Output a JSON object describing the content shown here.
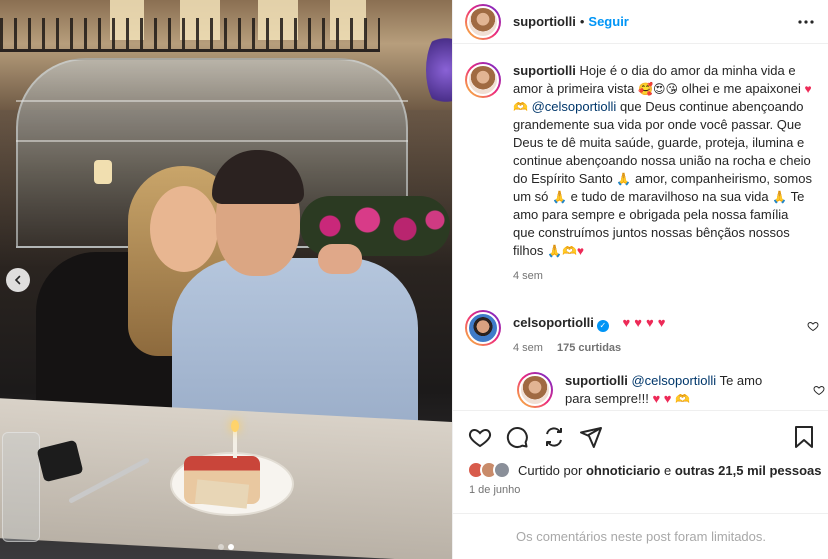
{
  "post": {
    "username": "suportiolli",
    "follow_label": "Seguir",
    "separator": "•"
  },
  "caption": {
    "username": "suportiolli",
    "text_1": "Hoje é o dia do amor da minha vida e amor à primeira vista",
    "text_2": "olhei e me apaixonei",
    "mention": "@celsoportiolli",
    "text_3": "que Deus continue abençoando grandemente sua vida por onde você passar. Que Deus te dê muita saúde, guarde, proteja, ilumina e continue abençoando nossa união na rocha e cheio do Espírito Santo",
    "text_4": "amor, companheirismo, somos um só",
    "text_5": "e tudo de maravilhoso na sua vida",
    "text_6": "Te amo para sempre e obrigada pela nossa família que construímos juntos nossas bênçãos nossos filhos",
    "time": "4 sem"
  },
  "comments": [
    {
      "username": "celsoportiolli",
      "verified": true,
      "text": "",
      "time": "4 sem",
      "likes": "175 curtidas"
    },
    {
      "username": "suportiolli",
      "mention": "@celsoportiolli",
      "text": "Te amo para sempre!!!"
    }
  ],
  "likes": {
    "prefix": "Curtido por",
    "user": "ohnoticiario",
    "middle": "e",
    "others": "outras 21,5 mil pessoas"
  },
  "date": "1 de junho",
  "comments_limited": "Os comentários neste post foram limitados.",
  "carousel": {
    "total": 2,
    "active_index": 1
  },
  "colors": {
    "follow": "#0095f6",
    "mention": "#00376b",
    "heart": "#ed2a57",
    "meta": "#737373"
  },
  "icons": [
    "more-icon",
    "heart-icon",
    "comment-icon",
    "share-icon",
    "send-icon",
    "bookmark-icon",
    "chevron-left-icon",
    "verified-icon"
  ]
}
